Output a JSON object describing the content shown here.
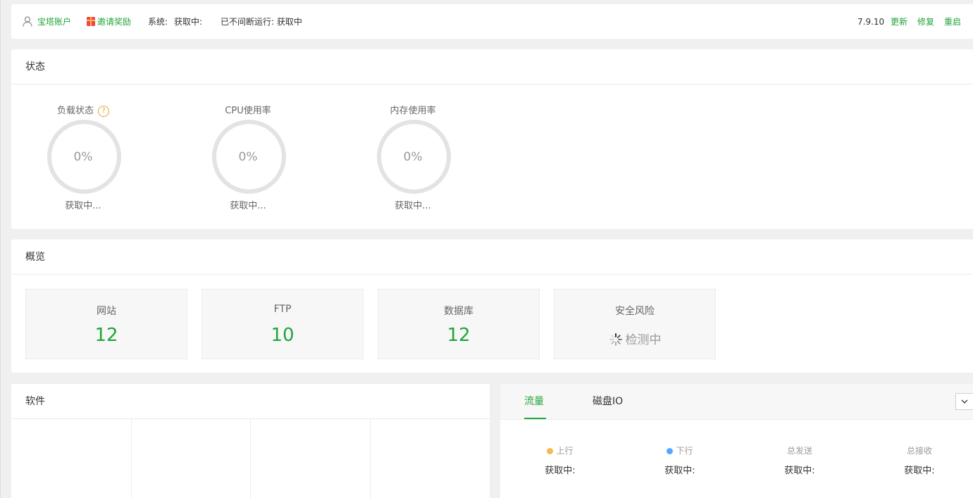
{
  "topbar": {
    "account": "宝塔账户",
    "invite": "邀请奖励",
    "system": "系统:",
    "system_value": "获取中:",
    "uptime": "已不间断运行: 获取中",
    "version": "7.9.10",
    "update": "更新",
    "repair": "修复",
    "restart": "重启"
  },
  "status": {
    "title": "状态",
    "gauges": [
      {
        "label": "负载状态",
        "value": "0%",
        "status": "获取中...",
        "level": 0
      },
      {
        "label": "CPU使用率",
        "value": "0%",
        "status": "获取中...",
        "level": 0
      },
      {
        "label": "内存使用率",
        "value": "0%",
        "status": "获取中...",
        "level": 0
      }
    ],
    "help_glyph": "?"
  },
  "overview": {
    "title": "概览",
    "cards": [
      {
        "label": "网站",
        "value": "12"
      },
      {
        "label": "FTP",
        "value": "10"
      },
      {
        "label": "数据库",
        "value": "12"
      },
      {
        "label": "安全风险",
        "value": "检测中"
      }
    ]
  },
  "software": {
    "title": "软件"
  },
  "traffic": {
    "tabs": [
      "流量",
      "磁盘IO"
    ],
    "active_tab": 0,
    "stats": [
      {
        "label": "上行",
        "value": "获取中:",
        "dot_color": "#f7b851"
      },
      {
        "label": "下行",
        "value": "获取中:",
        "dot_color": "#52a9ff"
      },
      {
        "label": "总发送",
        "value": "获取中:"
      },
      {
        "label": "总接收",
        "value": "获取中:"
      }
    ]
  },
  "colors": {
    "accent": "#20a53a",
    "risk_text": "#999999",
    "warning": "#e6a23c"
  }
}
